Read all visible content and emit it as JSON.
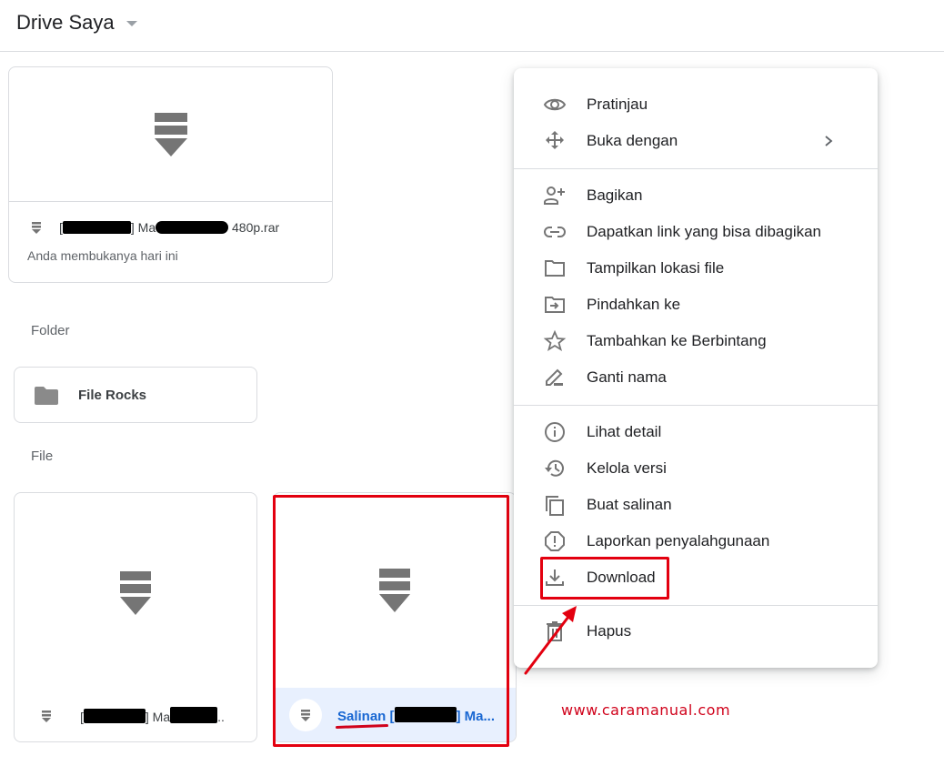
{
  "header": {
    "title": "Drive Saya"
  },
  "recent_card": {
    "file_name_prefix": "[",
    "file_name_mid": "] Ma",
    "file_name_suffix": " 480p.rar",
    "subtitle": "Anda membukanya hari ini",
    "icon": "archive-icon"
  },
  "sections": {
    "folder_label": "Folder",
    "file_label": "File"
  },
  "folders": [
    {
      "name": "File Rocks",
      "icon": "folder-icon"
    }
  ],
  "files": [
    {
      "name_prefix": "[",
      "name_mid": "] Ma",
      "name_suffix": "..",
      "icon": "archive-icon",
      "selected": false
    },
    {
      "name_prefix": "Salinan [",
      "name_mid": "] Ma...",
      "icon": "archive-icon",
      "selected": true
    }
  ],
  "context_menu": {
    "groups": [
      [
        {
          "label": "Pratinjau",
          "icon": "eye-icon"
        },
        {
          "label": "Buka dengan",
          "icon": "open-with-icon",
          "submenu": true
        }
      ],
      [
        {
          "label": "Bagikan",
          "icon": "person-add-icon"
        },
        {
          "label": "Dapatkan link yang bisa dibagikan",
          "icon": "link-icon"
        },
        {
          "label": "Tampilkan lokasi file",
          "icon": "folder-outline-icon"
        },
        {
          "label": "Pindahkan ke",
          "icon": "move-to-folder-icon"
        },
        {
          "label": "Tambahkan ke Berbintang",
          "icon": "star-icon"
        },
        {
          "label": "Ganti nama",
          "icon": "pencil-icon"
        }
      ],
      [
        {
          "label": "Lihat detail",
          "icon": "info-icon"
        },
        {
          "label": "Kelola versi",
          "icon": "history-icon"
        },
        {
          "label": "Buat salinan",
          "icon": "copy-icon"
        },
        {
          "label": "Laporkan penyalahgunaan",
          "icon": "report-icon"
        },
        {
          "label": "Download",
          "icon": "download-icon",
          "highlighted": true
        }
      ],
      [
        {
          "label": "Hapus",
          "icon": "trash-icon"
        }
      ]
    ]
  },
  "annotations": {
    "watermark": "www.caramanual.com",
    "highlight_color": "#e3000f"
  },
  "colors": {
    "selected_bg": "#e8f0fe",
    "selected_text": "#1967d2",
    "icon_gray": "#757575"
  }
}
